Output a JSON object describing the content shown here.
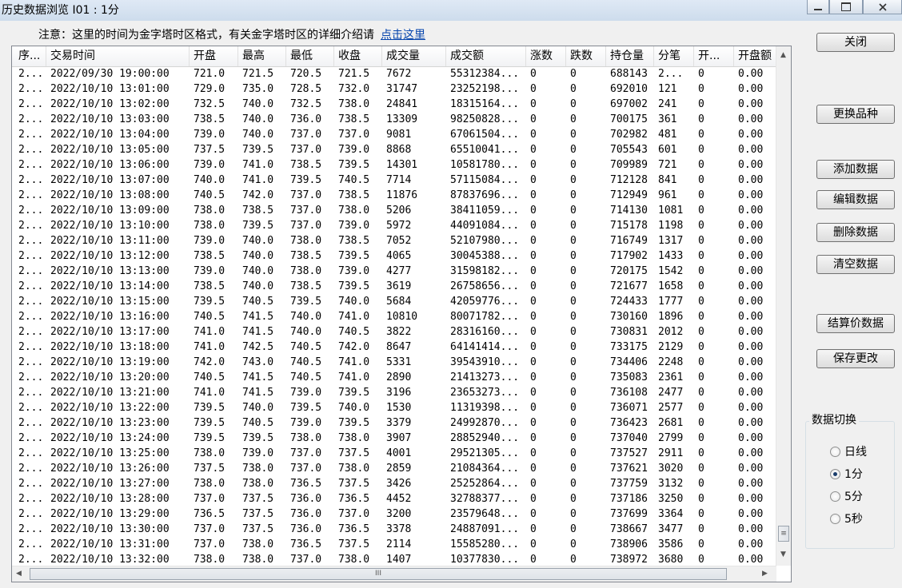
{
  "window": {
    "title": "历史数据浏览 I01 : 1分"
  },
  "notice": {
    "text": "注意：这里的时间为金字塔时区格式，有关金字塔时区的详细介绍请",
    "link": "点击这里"
  },
  "columns": [
    "序...",
    "交易时间",
    "开盘",
    "最高",
    "最低",
    "收盘",
    "成交量",
    "成交额",
    "涨数",
    "跌数",
    "持仓量",
    "分笔",
    "开...",
    "开盘额"
  ],
  "rows": [
    [
      "2...",
      "2022/09/30 19:00:00",
      "721.0",
      "721.5",
      "720.5",
      "721.5",
      "7672",
      "55312384...",
      "0",
      "0",
      "688143",
      "2...",
      "0",
      "0.00"
    ],
    [
      "2...",
      "2022/10/10 13:01:00",
      "729.0",
      "735.0",
      "728.5",
      "732.0",
      "31747",
      "23252198...",
      "0",
      "0",
      "692010",
      "121",
      "0",
      "0.00"
    ],
    [
      "2...",
      "2022/10/10 13:02:00",
      "732.5",
      "740.0",
      "732.5",
      "738.0",
      "24841",
      "18315164...",
      "0",
      "0",
      "697002",
      "241",
      "0",
      "0.00"
    ],
    [
      "2...",
      "2022/10/10 13:03:00",
      "738.5",
      "740.0",
      "736.0",
      "738.5",
      "13309",
      "98250828...",
      "0",
      "0",
      "700175",
      "361",
      "0",
      "0.00"
    ],
    [
      "2...",
      "2022/10/10 13:04:00",
      "739.0",
      "740.0",
      "737.0",
      "737.0",
      "9081",
      "67061504...",
      "0",
      "0",
      "702982",
      "481",
      "0",
      "0.00"
    ],
    [
      "2...",
      "2022/10/10 13:05:00",
      "737.5",
      "739.5",
      "737.0",
      "739.0",
      "8868",
      "65510041...",
      "0",
      "0",
      "705543",
      "601",
      "0",
      "0.00"
    ],
    [
      "2...",
      "2022/10/10 13:06:00",
      "739.0",
      "741.0",
      "738.5",
      "739.5",
      "14301",
      "10581780...",
      "0",
      "0",
      "709989",
      "721",
      "0",
      "0.00"
    ],
    [
      "2...",
      "2022/10/10 13:07:00",
      "740.0",
      "741.0",
      "739.5",
      "740.5",
      "7714",
      "57115084...",
      "0",
      "0",
      "712128",
      "841",
      "0",
      "0.00"
    ],
    [
      "2...",
      "2022/10/10 13:08:00",
      "740.5",
      "742.0",
      "737.0",
      "738.5",
      "11876",
      "87837696...",
      "0",
      "0",
      "712949",
      "961",
      "0",
      "0.00"
    ],
    [
      "2...",
      "2022/10/10 13:09:00",
      "738.0",
      "738.5",
      "737.0",
      "738.0",
      "5206",
      "38411059...",
      "0",
      "0",
      "714130",
      "1081",
      "0",
      "0.00"
    ],
    [
      "2...",
      "2022/10/10 13:10:00",
      "738.0",
      "739.5",
      "737.0",
      "739.0",
      "5972",
      "44091084...",
      "0",
      "0",
      "715178",
      "1198",
      "0",
      "0.00"
    ],
    [
      "2...",
      "2022/10/10 13:11:00",
      "739.0",
      "740.0",
      "738.0",
      "738.5",
      "7052",
      "52107980...",
      "0",
      "0",
      "716749",
      "1317",
      "0",
      "0.00"
    ],
    [
      "2...",
      "2022/10/10 13:12:00",
      "738.5",
      "740.0",
      "738.5",
      "739.5",
      "4065",
      "30045388...",
      "0",
      "0",
      "717902",
      "1433",
      "0",
      "0.00"
    ],
    [
      "2...",
      "2022/10/10 13:13:00",
      "739.0",
      "740.0",
      "738.0",
      "739.0",
      "4277",
      "31598182...",
      "0",
      "0",
      "720175",
      "1542",
      "0",
      "0.00"
    ],
    [
      "2...",
      "2022/10/10 13:14:00",
      "738.5",
      "740.0",
      "738.5",
      "739.5",
      "3619",
      "26758656...",
      "0",
      "0",
      "721677",
      "1658",
      "0",
      "0.00"
    ],
    [
      "2...",
      "2022/10/10 13:15:00",
      "739.5",
      "740.5",
      "739.5",
      "740.0",
      "5684",
      "42059776...",
      "0",
      "0",
      "724433",
      "1777",
      "0",
      "0.00"
    ],
    [
      "2...",
      "2022/10/10 13:16:00",
      "740.5",
      "741.5",
      "740.0",
      "741.0",
      "10810",
      "80071782...",
      "0",
      "0",
      "730160",
      "1896",
      "0",
      "0.00"
    ],
    [
      "2...",
      "2022/10/10 13:17:00",
      "741.0",
      "741.5",
      "740.0",
      "740.5",
      "3822",
      "28316160...",
      "0",
      "0",
      "730831",
      "2012",
      "0",
      "0.00"
    ],
    [
      "2...",
      "2022/10/10 13:18:00",
      "741.0",
      "742.5",
      "740.5",
      "742.0",
      "8647",
      "64141414...",
      "0",
      "0",
      "733175",
      "2129",
      "0",
      "0.00"
    ],
    [
      "2...",
      "2022/10/10 13:19:00",
      "742.0",
      "743.0",
      "740.5",
      "741.0",
      "5331",
      "39543910...",
      "0",
      "0",
      "734406",
      "2248",
      "0",
      "0.00"
    ],
    [
      "2...",
      "2022/10/10 13:20:00",
      "740.5",
      "741.5",
      "740.5",
      "741.0",
      "2890",
      "21413273...",
      "0",
      "0",
      "735083",
      "2361",
      "0",
      "0.00"
    ],
    [
      "2...",
      "2022/10/10 13:21:00",
      "741.0",
      "741.5",
      "739.0",
      "739.5",
      "3196",
      "23653273...",
      "0",
      "0",
      "736108",
      "2477",
      "0",
      "0.00"
    ],
    [
      "2...",
      "2022/10/10 13:22:00",
      "739.5",
      "740.0",
      "739.5",
      "740.0",
      "1530",
      "11319398...",
      "0",
      "0",
      "736071",
      "2577",
      "0",
      "0.00"
    ],
    [
      "2...",
      "2022/10/10 13:23:00",
      "739.5",
      "740.5",
      "739.0",
      "739.5",
      "3379",
      "24992870...",
      "0",
      "0",
      "736423",
      "2681",
      "0",
      "0.00"
    ],
    [
      "2...",
      "2022/10/10 13:24:00",
      "739.5",
      "739.5",
      "738.0",
      "738.0",
      "3907",
      "28852940...",
      "0",
      "0",
      "737040",
      "2799",
      "0",
      "0.00"
    ],
    [
      "2...",
      "2022/10/10 13:25:00",
      "738.0",
      "739.0",
      "737.0",
      "737.5",
      "4001",
      "29521305...",
      "0",
      "0",
      "737527",
      "2911",
      "0",
      "0.00"
    ],
    [
      "2...",
      "2022/10/10 13:26:00",
      "737.5",
      "738.0",
      "737.0",
      "738.0",
      "2859",
      "21084364...",
      "0",
      "0",
      "737621",
      "3020",
      "0",
      "0.00"
    ],
    [
      "2...",
      "2022/10/10 13:27:00",
      "738.0",
      "738.0",
      "736.5",
      "737.5",
      "3426",
      "25252864...",
      "0",
      "0",
      "737759",
      "3132",
      "0",
      "0.00"
    ],
    [
      "2...",
      "2022/10/10 13:28:00",
      "737.0",
      "737.5",
      "736.0",
      "736.5",
      "4452",
      "32788377...",
      "0",
      "0",
      "737186",
      "3250",
      "0",
      "0.00"
    ],
    [
      "2...",
      "2022/10/10 13:29:00",
      "736.5",
      "737.5",
      "736.0",
      "737.0",
      "3200",
      "23579648...",
      "0",
      "0",
      "737699",
      "3364",
      "0",
      "0.00"
    ],
    [
      "2...",
      "2022/10/10 13:30:00",
      "737.0",
      "737.5",
      "736.0",
      "736.5",
      "3378",
      "24887091...",
      "0",
      "0",
      "738667",
      "3477",
      "0",
      "0.00"
    ],
    [
      "2...",
      "2022/10/10 13:31:00",
      "737.0",
      "738.0",
      "736.5",
      "737.5",
      "2114",
      "15585280...",
      "0",
      "0",
      "738906",
      "3586",
      "0",
      "0.00"
    ],
    [
      "2...",
      "2022/10/10 13:32:00",
      "738.0",
      "738.0",
      "737.0",
      "738.0",
      "1407",
      "10377830...",
      "0",
      "0",
      "738972",
      "3680",
      "0",
      "0.00"
    ]
  ],
  "buttons": {
    "close": "关闭",
    "change_symbol": "更换品种",
    "add": "添加数据",
    "edit": "编辑数据",
    "delete": "删除数据",
    "clear": "清空数据",
    "settlement": "结算价数据",
    "save": "保存更改"
  },
  "switch": {
    "label": "数据切换",
    "options": [
      {
        "label": "日线",
        "selected": false
      },
      {
        "label": "1分",
        "selected": true
      },
      {
        "label": "5分",
        "selected": false
      },
      {
        "label": "5秒",
        "selected": false
      }
    ]
  },
  "icons": {
    "minimize": "minimize-icon",
    "maximize": "maximize-icon",
    "close": "close-icon",
    "grip": "grip-icon"
  },
  "glyphs": {
    "scroll_up": "▲",
    "scroll_down": "▼",
    "scroll_left": "◀",
    "scroll_right": "▶",
    "hgrip": "III",
    "vgrip": "≡"
  },
  "colors": {
    "link": "#0645ad",
    "titlebar": "#dfe9f5"
  }
}
